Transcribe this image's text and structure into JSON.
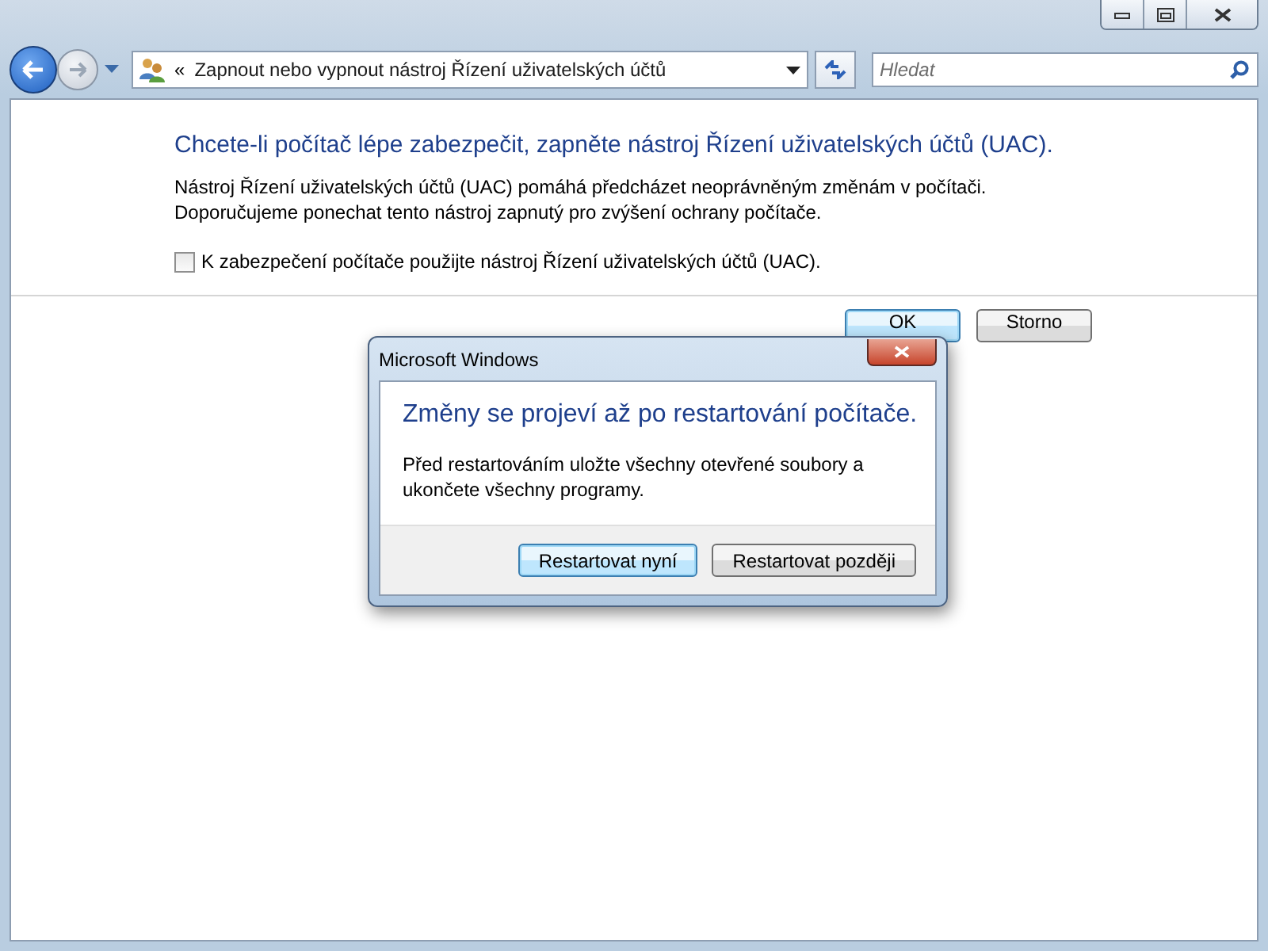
{
  "nav": {
    "breadcrumb_chevron": "«",
    "address": "Zapnout nebo vypnout nástroj Řízení uživatelských účtů",
    "search": {
      "placeholder": "Hledat"
    }
  },
  "content": {
    "heading": "Chcete-li počítač lépe zabezpečit, zapněte nástroj Řízení uživatelských účtů (UAC).",
    "description": [
      "Nástroj Řízení uživatelských účtů (UAC) pomáhá předcházet neoprávněným změnám v počítači.",
      "Doporučujeme ponechat tento nástroj zapnutý pro zvýšení ochrany počítače."
    ],
    "checkbox": {
      "label": "K zabezpečení počítače použijte nástroj Řízení uživatelských účtů (UAC).",
      "checked": false
    },
    "buttons": [
      {
        "label": "OK",
        "default": true
      },
      {
        "label": "Storno",
        "default": false
      }
    ]
  },
  "dialog": {
    "title": "Microsoft Windows",
    "heading": "Změny se projeví až po restartování počítače.",
    "message": "Před restartováním uložte všechny otevřené soubory a ukončete všechny programy.",
    "buttons": [
      {
        "label": "Restartovat nyní",
        "default": true
      },
      {
        "label": "Restartovat později",
        "default": false
      }
    ]
  }
}
